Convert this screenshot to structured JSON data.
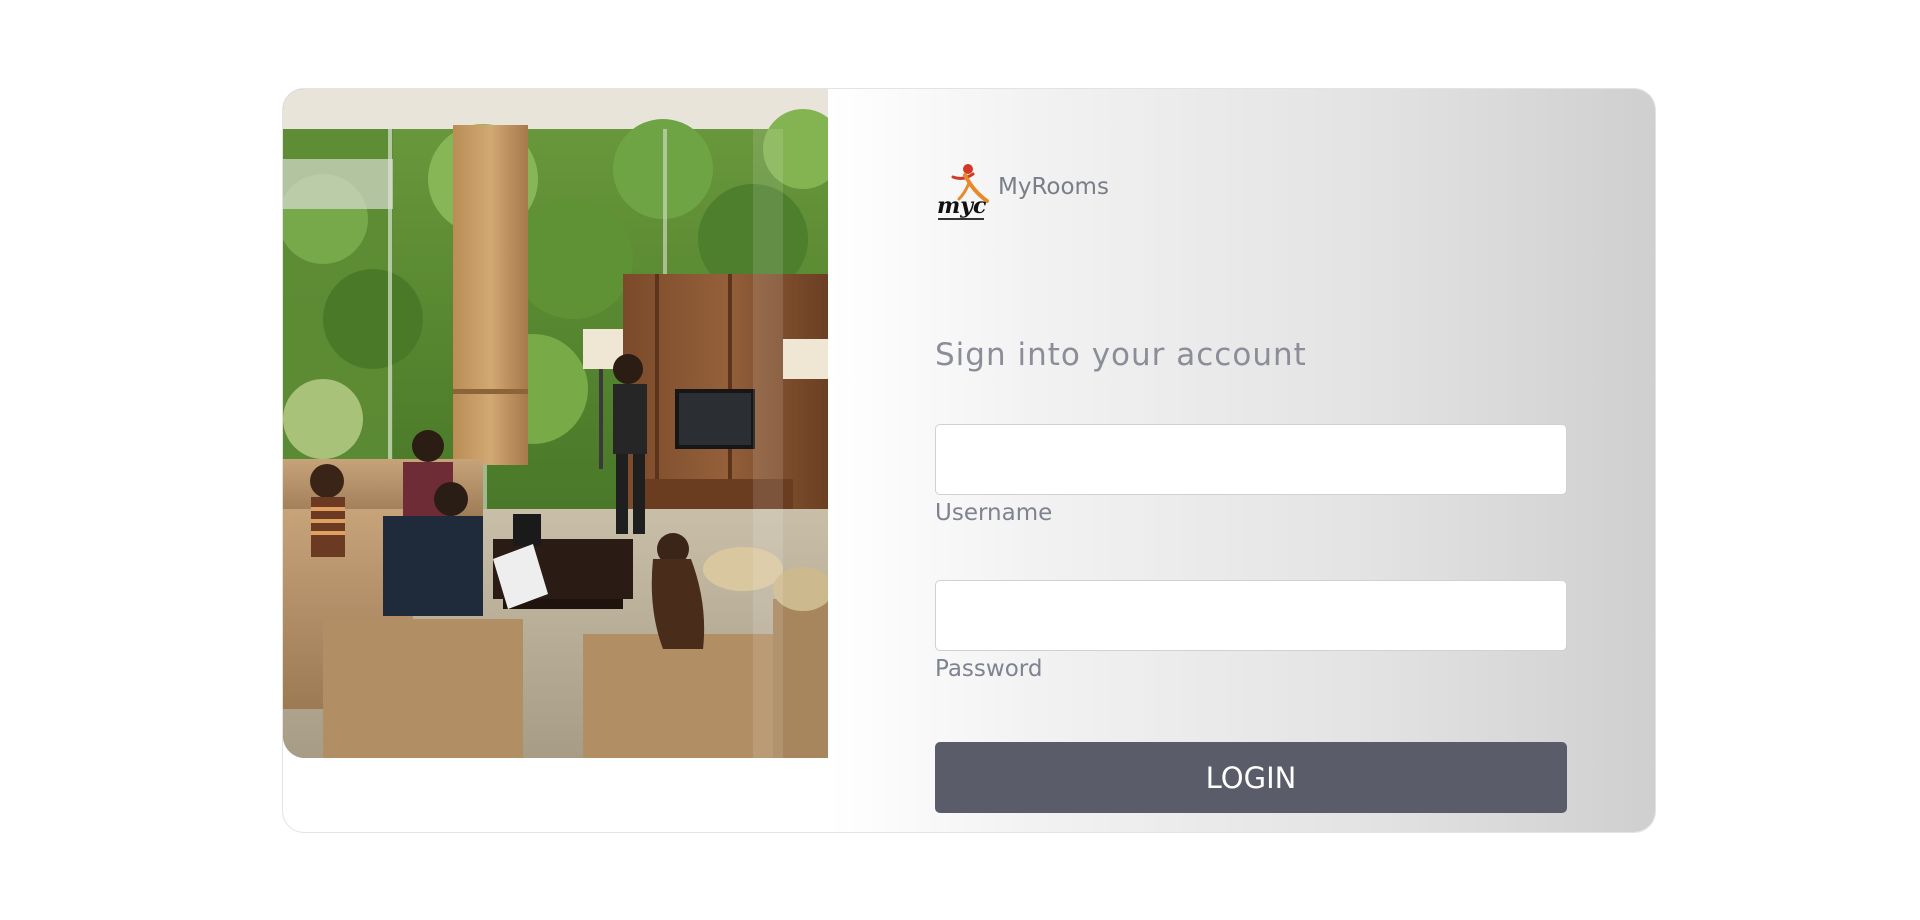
{
  "brand": {
    "logo_text": "myc",
    "name": "MyRooms"
  },
  "heading": "Sign into your account",
  "form": {
    "username_label": "Username",
    "username_value": "",
    "password_label": "Password",
    "password_value": "",
    "login_label": "LOGIN"
  },
  "photo": {
    "icon": "lounge-photo"
  },
  "colors": {
    "button": "#5b5c6a",
    "label": "#7f8390",
    "heading": "#8b8e98",
    "brand_orange": "#e8892a",
    "brand_red": "#d23a25"
  }
}
